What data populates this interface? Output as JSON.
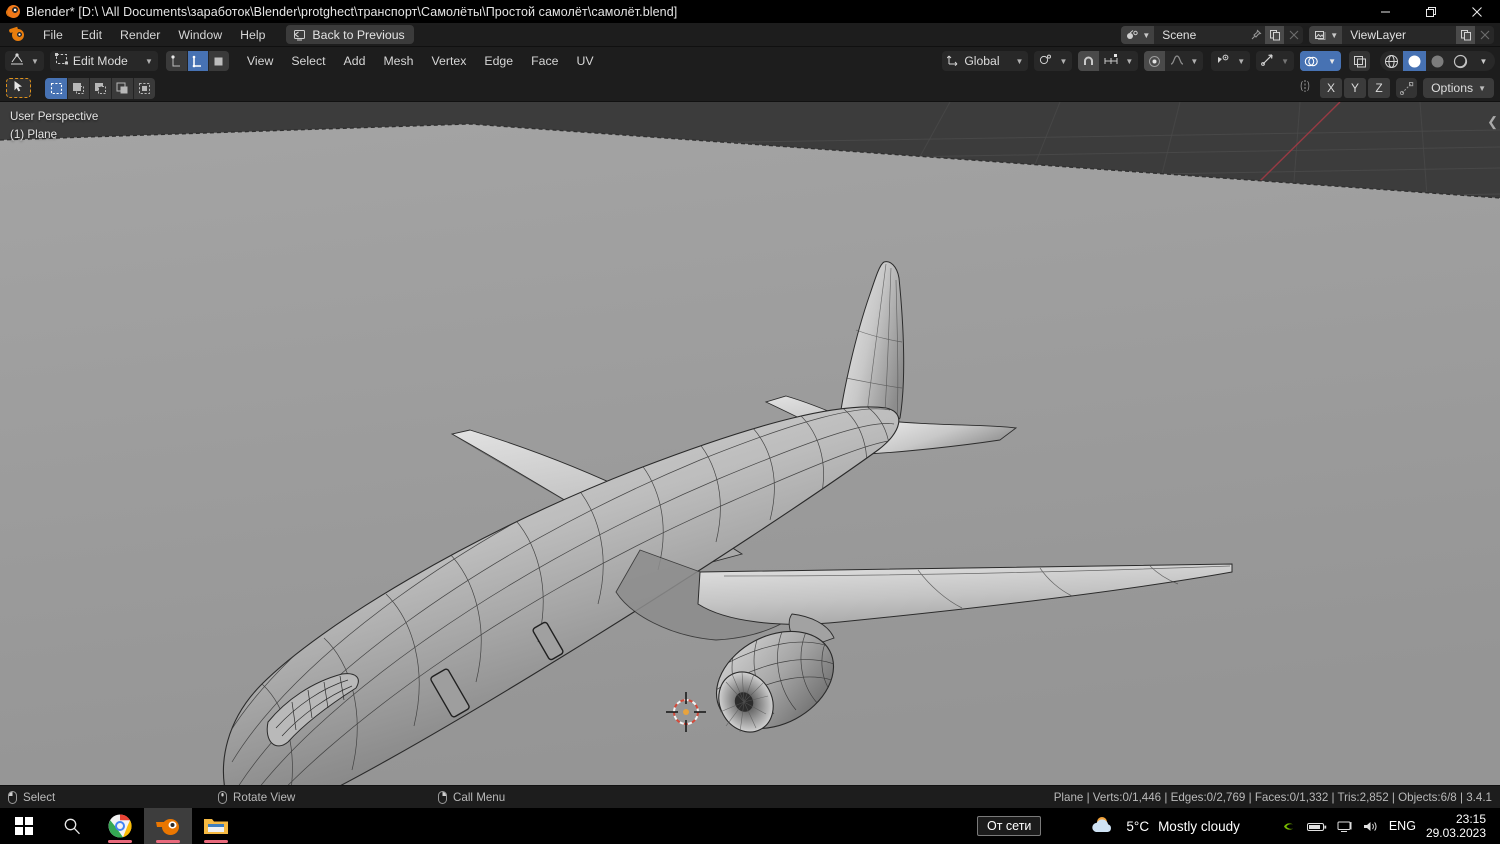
{
  "window": {
    "title": "Blender* [D:\\ \\All Documents\\заработок\\Blender\\protghect\\транспорт\\Самолёты\\Простой самолёт\\самолёт.blend]",
    "app_icon": "blender-logo-icon",
    "controls": {
      "minimize": "minimize-icon",
      "restore": "restore-icon",
      "close": "close-icon"
    }
  },
  "topbar": {
    "logo": "blender-logo-icon",
    "menus": [
      "File",
      "Edit",
      "Render",
      "Window",
      "Help"
    ],
    "back_button": {
      "label": "Back to Previous",
      "icon": "back-to-previous-icon"
    },
    "scene": {
      "icon": "scene-icon",
      "value": "Scene",
      "pin": "pin-icon",
      "new": "duplicate-icon",
      "remove": "close-icon"
    },
    "viewlayer": {
      "icon": "viewlayer-icon",
      "value": "ViewLayer",
      "new": "duplicate-icon",
      "remove": "close-icon"
    }
  },
  "viewport_header": {
    "editor_type_icon": "editor-type-icon",
    "mode": {
      "icon": "edit-mode-icon",
      "label": "Edit Mode"
    },
    "select_modes": [
      {
        "name": "vertex-select-mode",
        "icon": "vertex-icon",
        "active": false
      },
      {
        "name": "edge-select-mode",
        "icon": "edge-icon",
        "active": true
      },
      {
        "name": "face-select-mode",
        "icon": "face-icon",
        "active": false
      }
    ],
    "menus": [
      "View",
      "Select",
      "Add",
      "Mesh",
      "Vertex",
      "Edge",
      "Face",
      "UV"
    ],
    "transform_orientation": {
      "icon": "orientation-icon",
      "label": "Global"
    },
    "pivot_icon": "pivot-point-icon",
    "snap": {
      "magnet_icon": "magnet-icon",
      "snap_to_icon": "snap-increment-icon",
      "active": true
    },
    "proportional": {
      "icon": "proportional-editing-icon",
      "falloff_icon": "smooth-falloff-icon",
      "active": true
    },
    "visibility_icon": "object-visibility-icon",
    "gizmo_icon": "gizmo-icon",
    "overlays": {
      "icon": "overlays-icon",
      "active": true
    },
    "xray_icon": "toggle-xray-icon",
    "shading": [
      {
        "name": "wireframe-shading",
        "icon": "wireframe-icon",
        "active": false
      },
      {
        "name": "solid-shading",
        "icon": "solid-sphere-icon",
        "active": true
      },
      {
        "name": "material-preview-shading",
        "icon": "material-icon",
        "active": false
      },
      {
        "name": "rendered-shading",
        "icon": "rendered-icon",
        "active": false
      }
    ]
  },
  "tool_row": {
    "active_tool": {
      "name": "tweak-select-tool",
      "icon": "cursor-arrow-icon"
    },
    "select_modes": [
      {
        "name": "select-set",
        "icon": "select-new-icon",
        "active": true
      },
      {
        "name": "select-extend",
        "icon": "select-extend-icon",
        "active": false
      },
      {
        "name": "select-subtract",
        "icon": "select-subtract-icon",
        "active": false
      },
      {
        "name": "select-invert",
        "icon": "select-invert-icon",
        "active": false
      },
      {
        "name": "select-intersect",
        "icon": "select-intersect-icon",
        "active": false
      }
    ],
    "mirror": {
      "icon": "mirror-icon",
      "axes": [
        "X",
        "Y",
        "Z"
      ]
    },
    "auto_merge_icon": "auto-merge-icon",
    "options": {
      "label": "Options",
      "chevron": "chevron-down-icon"
    }
  },
  "viewport": {
    "perspective_text": "User Perspective",
    "object_text": "(1) Plane",
    "collapse_icon": "sidebar-collapse-icon",
    "cursor_icon": "3d-cursor-icon",
    "colors": {
      "sky": "#3a3a3a",
      "plane": "#9d9d9d",
      "x_axis": "#a33b44",
      "grid_line": "#4a4a4a",
      "wire": "#2b2b2b"
    }
  },
  "statusbar": {
    "hints": [
      {
        "icon": "mouse-left-icon",
        "label": "Select"
      },
      {
        "icon": "mouse-middle-icon",
        "label": "Rotate View"
      },
      {
        "icon": "mouse-right-icon",
        "label": "Call Menu"
      }
    ],
    "stats": "Plane | Verts:0/1,446 | Edges:0/2,769 | Faces:0/1,332 | Tris:2,852 | Objects:6/8 | 3.4.1"
  },
  "taskbar": {
    "start_icon": "windows-start-icon",
    "search_icon": "search-icon",
    "apps": [
      {
        "name": "chrome-taskbar-icon",
        "icon": "chrome-icon",
        "active": false
      },
      {
        "name": "blender-taskbar-icon",
        "icon": "blender-icon",
        "active": true
      },
      {
        "name": "explorer-taskbar-icon",
        "icon": "folder-icon",
        "active": false
      }
    ],
    "network_tooltip": "От сети",
    "weather": {
      "icon": "partly-cloudy-icon",
      "temperature": "5°C",
      "condition": "Mostly cloudy"
    },
    "tray_icons": [
      "nvidia-icon",
      "battery-icon",
      "network-icon",
      "volume-icon"
    ],
    "language": "ENG",
    "time": "23:15",
    "date": "29.03.2023"
  }
}
